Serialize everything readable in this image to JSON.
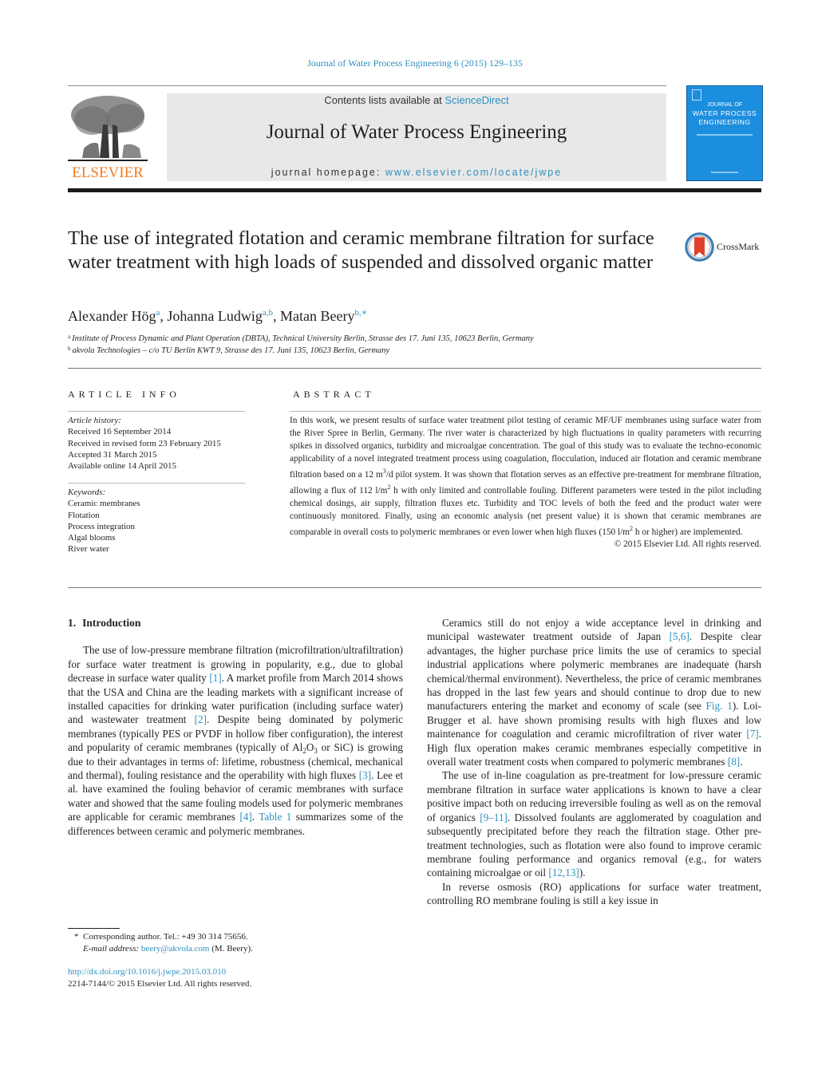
{
  "header": {
    "citation": "Journal of Water Process Engineering 6 (2015) 129–135",
    "contents_prefix": "Contents lists available at ",
    "contents_link": "ScienceDirect",
    "journal_name": "Journal of Water Process Engineering",
    "homepage_prefix": "journal homepage: ",
    "homepage_link": "www.elsevier.com/locate/jwpe",
    "publisher_wordmark": "ELSEVIER",
    "cover": {
      "line1": "JOURNAL OF",
      "line2": "WATER PROCESS",
      "line3": "ENGINEERING"
    },
    "colors": {
      "link": "#2e90bf",
      "elsevier_orange": "#f07e26",
      "cover_blue": "#1c8ede"
    }
  },
  "article": {
    "title": "The use of integrated flotation and ceramic membrane filtration for surface water treatment with high loads of suspended and dissolved organic matter",
    "crossmark_label": "CrossMark",
    "authors": [
      {
        "name": "Alexander Hög",
        "sup": "a",
        "sep": ", "
      },
      {
        "name": "Johanna Ludwig",
        "sup": "a,b",
        "sep": ", "
      },
      {
        "name": "Matan Beery",
        "sup": "b,∗",
        "sep": ""
      }
    ],
    "affiliations": [
      {
        "key": "a",
        "text": "Institute of Process Dynamic and Plant Operation (DBTA), Technical University Berlin, Strasse des 17. Juni 135, 10623 Berlin, Germany"
      },
      {
        "key": "b",
        "text": "akvola Technologies – c/o TU Berlin KWT 9, Strasse des 17. Juni 135, 10623 Berlin, Germany"
      }
    ]
  },
  "article_info": {
    "heading": "ARTICLE INFO",
    "history_label": "Article history:",
    "history": [
      "Received 16 September 2014",
      "Received in revised form 23 February 2015",
      "Accepted 31 March 2015",
      "Available online 14 April 2015"
    ],
    "keywords_label": "Keywords:",
    "keywords": [
      "Ceramic membranes",
      "Flotation",
      "Process integration",
      "Algal blooms",
      "River water"
    ]
  },
  "abstract": {
    "heading": "ABSTRACT",
    "part1": "In this work, we present results of surface water treatment pilot testing of ceramic MF/UF membranes using surface water from the River Spree in Berlin, Germany. The river water is characterized by high fluctuations in quality parameters with recurring spikes in dissolved organics, turbidity and microalgae concentration. The goal of this study was to evaluate the techno-economic applicability of a novel integrated treatment process using coagulation, flocculation, induced air flotation and ceramic membrane filtration based on a 12 m",
    "part1_sup": "3",
    "part2": "/d pilot system. It was shown that flotation serves as an effective pre-treatment for membrane filtration, allowing a flux of 112 l/m",
    "part2_sup": "2",
    "part3": " h with only limited and controllable fouling. Different parameters were tested in the pilot including chemical dosings, air supply, filtration fluxes etc. Turbidity and TOC levels of both the feed and the product water were continuously monitored. Finally, using an economic analysis (net present value) it is shown that ceramic membranes are comparable in overall costs to polymeric membranes or even lower when high fluxes (150 l/m",
    "part3_sup": "2",
    "part4": " h or higher) are implemented.",
    "copyright": "© 2015 Elsevier Ltd. All rights reserved."
  },
  "body": {
    "section_number": "1.",
    "section_title": "Introduction",
    "left_p1": {
      "t1": "The use of low-pressure membrane filtration (microfiltration/ultrafiltration) for surface water treatment is growing in popularity, e.g., due to global decrease in surface water quality ",
      "r1": "[1]",
      "t2": ". A market profile from March 2014 shows that the USA and China are the leading markets with a significant increase of installed capacities for drinking water purification (including surface water) and wastewater treatment ",
      "r2": "[2]",
      "t3": ". Despite being dominated by polymeric membranes (typically PES or PVDF in hollow fiber configuration), the interest and popularity of ceramic membranes (typically of Al",
      "sub1": "2",
      "t4": "O",
      "sub2": "3",
      "t5": " or SiC) is growing due to their advantages in terms of: lifetime, robustness (chemical, mechanical and thermal), fouling resistance and the operability with high fluxes ",
      "r3": "[3]",
      "t6": ". Lee et al. have examined the fouling behavior of ceramic membranes with surface water and showed that the same fouling models used for polymeric membranes are applicable for ceramic membranes ",
      "r4": "[4]",
      "t7": ". ",
      "r5": "Table 1",
      "t8": " summarizes some of the differences between ceramic and polymeric membranes."
    },
    "right_p1": {
      "t1": "Ceramics still do not enjoy a wide acceptance level in drinking and municipal wastewater treatment outside of Japan ",
      "r1": "[5,6]",
      "t2": ". Despite clear advantages, the higher purchase price limits the use of ceramics to special industrial applications where polymeric membranes are inadequate (harsh chemical/thermal environment). Nevertheless, the price of ceramic membranes has dropped in the last few years and should continue to drop due to new manufacturers entering the market and economy of scale (see ",
      "r2": "Fig. 1",
      "t3": "). Loi-Brugger et al. have shown promising results with high fluxes and low maintenance for coagulation and ceramic microfiltration of river water ",
      "r3": "[7]",
      "t4": ". High flux operation makes ceramic membranes especially competitive in overall water treatment costs when compared to polymeric membranes ",
      "r4": "[8]",
      "t5": "."
    },
    "right_p2": {
      "t1": "The use of in-line coagulation as pre-treatment for low-pressure ceramic membrane filtration in surface water applications is known to have a clear positive impact both on reducing irreversible fouling as well as on the removal of organics ",
      "r1": "[9–11]",
      "t2": ". Dissolved foulants are agglomerated by coagulation and subsequently precipitated before they reach the filtration stage. Other pre-treatment technologies, such as flotation were also found to improve ceramic membrane fouling performance and organics removal (e.g., for waters containing microalgae or oil ",
      "r2": "[12,13]",
      "t3": ")."
    },
    "right_p3": {
      "t1": "In reverse osmosis (RO) applications for surface water treatment, controlling RO membrane fouling is still a key issue in"
    }
  },
  "footnote": {
    "marker": "*",
    "corresponding": "Corresponding author. Tel.: +49 30 314 75656.",
    "email_label": "E-mail address:",
    "email": "beery@akvola.com",
    "email_suffix": " (M. Beery).",
    "doi": "http://dx.doi.org/10.1016/j.jwpe.2015.03.010",
    "issn_line": "2214-7144/© 2015 Elsevier Ltd. All rights reserved."
  }
}
